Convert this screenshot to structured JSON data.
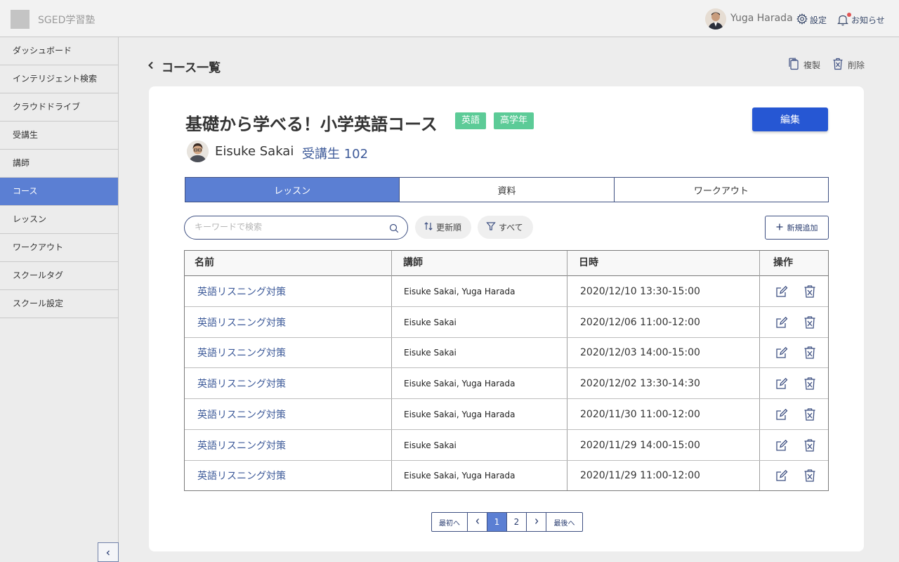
{
  "header": {
    "app_name": "SGED学習塾",
    "user_name": "Yuga Harada",
    "settings_label": "設定",
    "notices_label": "お知らせ"
  },
  "sidebar": {
    "items": [
      {
        "label": "ダッシュボード"
      },
      {
        "label": "インテリジェント検索"
      },
      {
        "label": "クラウドドライブ"
      },
      {
        "label": "受講生"
      },
      {
        "label": "講師"
      },
      {
        "label": "コース",
        "active": true
      },
      {
        "label": "レッスン"
      },
      {
        "label": "ワークアウト"
      },
      {
        "label": "スクールタグ"
      },
      {
        "label": "スクール設定"
      }
    ]
  },
  "page": {
    "back_label": "コース一覧",
    "copy_label": "複製",
    "delete_label": "削除"
  },
  "course": {
    "title": "基礎から学べる！小学英語コース",
    "tags": [
      "英語",
      "高学年"
    ],
    "edit_label": "編集",
    "teacher": "Eisuke Sakai",
    "students": "受講生 102"
  },
  "tabs": [
    {
      "label": "レッスン",
      "active": true
    },
    {
      "label": "資料"
    },
    {
      "label": "ワークアウト"
    }
  ],
  "toolbar": {
    "search_placeholder": "キーワードで検索",
    "sort_label": "更新順",
    "filter_label": "すべて",
    "add_label": "新規追加"
  },
  "table": {
    "headers": [
      "名前",
      "講師",
      "日時",
      "操作"
    ],
    "rows": [
      {
        "name": "英語リスニング対策",
        "teacher": "Eisuke Sakai, Yuga Harada",
        "datetime": "2020/12/10 13:30-15:00"
      },
      {
        "name": "英語リスニング対策",
        "teacher": "Eisuke Sakai",
        "datetime": "2020/12/06 11:00-12:00"
      },
      {
        "name": "英語リスニング対策",
        "teacher": "Eisuke Sakai",
        "datetime": "2020/12/03 14:00-15:00"
      },
      {
        "name": "英語リスニング対策",
        "teacher": "Eisuke Sakai, Yuga Harada",
        "datetime": "2020/12/02 13:30-14:30"
      },
      {
        "name": "英語リスニング対策",
        "teacher": "Eisuke Sakai, Yuga Harada",
        "datetime": "2020/11/30 11:00-12:00"
      },
      {
        "name": "英語リスニング対策",
        "teacher": "Eisuke Sakai",
        "datetime": "2020/11/29 14:00-15:00"
      },
      {
        "name": "英語リスニング対策",
        "teacher": "Eisuke Sakai, Yuga Harada",
        "datetime": "2020/11/29 11:00-12:00"
      }
    ]
  },
  "pagination": {
    "first_label": "最初へ",
    "last_label": "最後へ",
    "pages": [
      "1",
      "2"
    ],
    "current": "1"
  },
  "icons": {
    "user_avatar": "avatar-photo",
    "settings": "gear-icon",
    "notices": "bell-icon",
    "back": "chevron-left-icon",
    "copy": "copy-icon",
    "delete": "trash-icon",
    "search": "search-icon",
    "sort": "sort-icon",
    "filter": "filter-icon",
    "add": "plus-icon",
    "row_edit": "edit-icon",
    "row_delete": "trash-icon"
  },
  "colors": {
    "accent": "#5b7fd3",
    "primary_button": "#2657d3",
    "tag": "#5ccb97",
    "link": "#3d5a99"
  }
}
